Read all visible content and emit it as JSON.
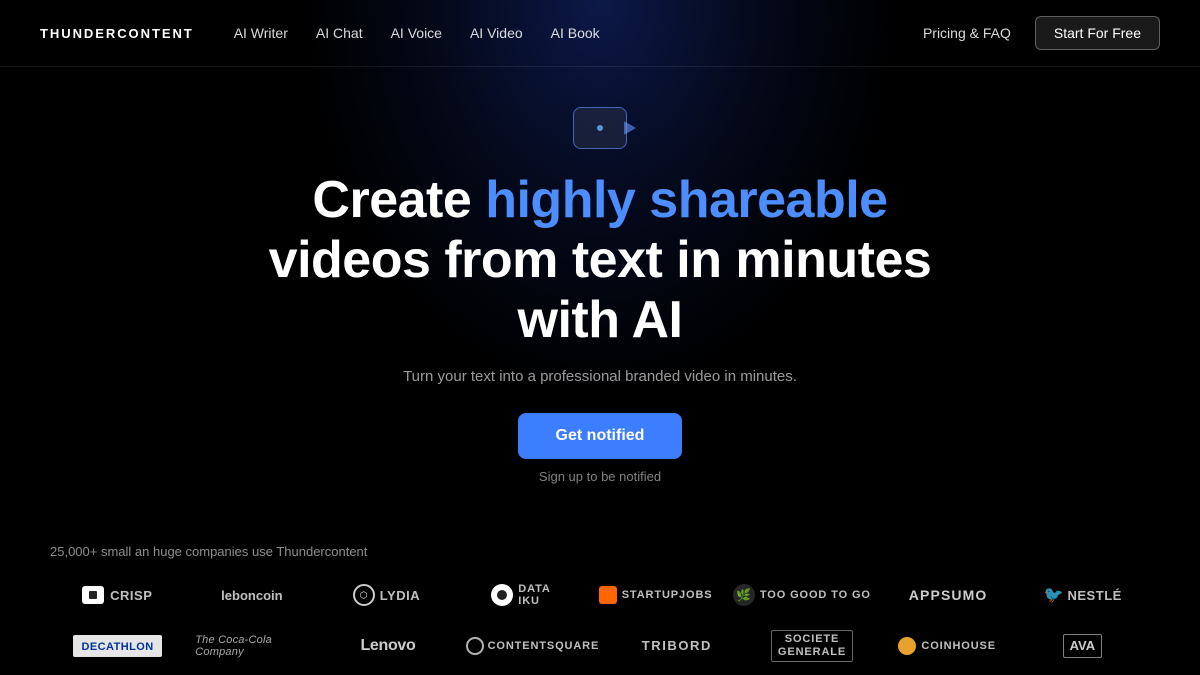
{
  "nav": {
    "logo": "THUNDERCONTENT",
    "links": [
      {
        "label": "AI Writer",
        "id": "ai-writer"
      },
      {
        "label": "AI Chat",
        "id": "ai-chat"
      },
      {
        "label": "AI Voice",
        "id": "ai-voice"
      },
      {
        "label": "AI Video",
        "id": "ai-video"
      },
      {
        "label": "AI Book",
        "id": "ai-book"
      }
    ],
    "pricing_label": "Pricing & FAQ",
    "cta_label": "Start For Free"
  },
  "hero": {
    "title_start": "Create ",
    "title_highlight": "highly shareable",
    "title_end": " videos from text in minutes with AI",
    "subtitle": "Turn your text into a professional branded video in minutes.",
    "cta_label": "Get notified",
    "sign_up_note": "Sign up to be notified"
  },
  "logos": {
    "label": "25,000+ small an huge companies use Thundercontent",
    "row1": [
      {
        "id": "crisp",
        "display": "crisp"
      },
      {
        "id": "leboncoin",
        "display": "leboncoin"
      },
      {
        "id": "lydia",
        "display": "Lydia"
      },
      {
        "id": "dataiku",
        "display": "data iku"
      },
      {
        "id": "startupjobs",
        "display": "STARTUPJOBS"
      },
      {
        "id": "tgtg",
        "display": "Too Good To Go"
      },
      {
        "id": "appsumo",
        "display": "APPSUMO"
      },
      {
        "id": "nestle",
        "display": "Nestlé"
      }
    ],
    "row2": [
      {
        "id": "decathlon",
        "display": "DECATHLON"
      },
      {
        "id": "cocacola",
        "display": "The Coca-Cola Company"
      },
      {
        "id": "lenovo",
        "display": "Lenovo"
      },
      {
        "id": "contentsquare",
        "display": "Contentsquare"
      },
      {
        "id": "tribord",
        "display": "TRIBORD"
      },
      {
        "id": "sg",
        "display": "SOCIETE GENERALE"
      },
      {
        "id": "coinhouse",
        "display": "coinhouse"
      },
      {
        "id": "ava",
        "display": "AVA"
      }
    ]
  }
}
